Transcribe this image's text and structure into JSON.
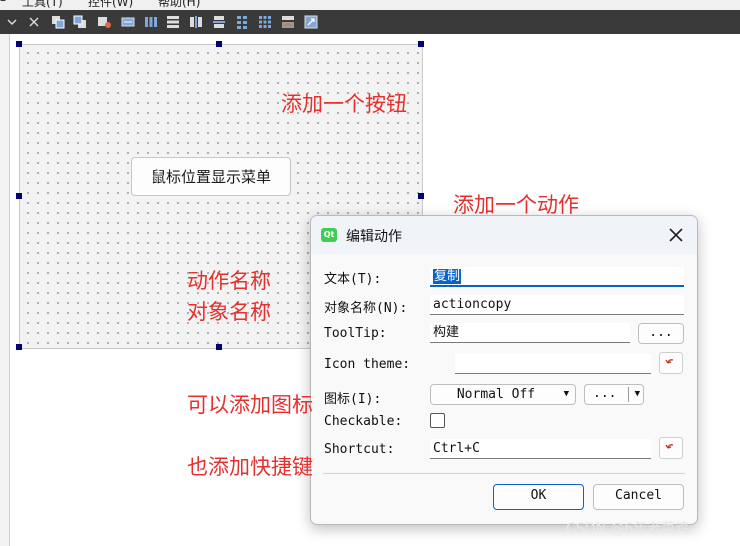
{
  "menubar": {
    "items": [
      "工具(T)",
      "控件(W)",
      "帮助(H)"
    ]
  },
  "toolbar": {
    "icons": [
      "close-icon",
      "bring-front-icon",
      "send-back-icon",
      "edit-tab-order-icon",
      "edit-buddies-icon",
      "layout-horizontal-icon",
      "layout-vertical-icon",
      "layout-horizontal-splitter-icon",
      "layout-vertical-splitter-icon",
      "layout-grid-icon",
      "layout-form-icon",
      "break-layout-icon",
      "adjust-size-icon"
    ]
  },
  "form": {
    "button_label": "鼠标位置显示菜单"
  },
  "annotations": {
    "add_button": "添加一个按钮",
    "add_action": "添加一个动作",
    "action_name": "动作名称",
    "object_name": "对象名称",
    "add_icon": "可以添加图标",
    "add_shortcut": "也添加快捷键"
  },
  "dialog": {
    "title": "编辑动作",
    "text_label": "文本(T):",
    "text_value": "复制",
    "object_name_label": "对象名称(N):",
    "object_name_value": "actioncopy",
    "tooltip_label": "ToolTip:",
    "tooltip_value": "构建",
    "tooltip_more": "...",
    "icon_theme_label": "Icon theme:",
    "icon_theme_value": "",
    "icon_label": "图标(I):",
    "icon_mode": "Normal Off",
    "icon_more": "...",
    "checkable_label": "Checkable:",
    "checkable_checked": false,
    "shortcut_label": "Shortcut:",
    "shortcut_value": "Ctrl+C",
    "ok": "OK",
    "cancel": "Cancel"
  },
  "watermark": "CSDN @6年老菜鸡",
  "colors": {
    "annotation": "#e5302d",
    "selection_handle": "#000080",
    "toolbar": "#3a3a3a",
    "qt_green": "#41cd52",
    "text_highlight": "#0a63c9"
  }
}
